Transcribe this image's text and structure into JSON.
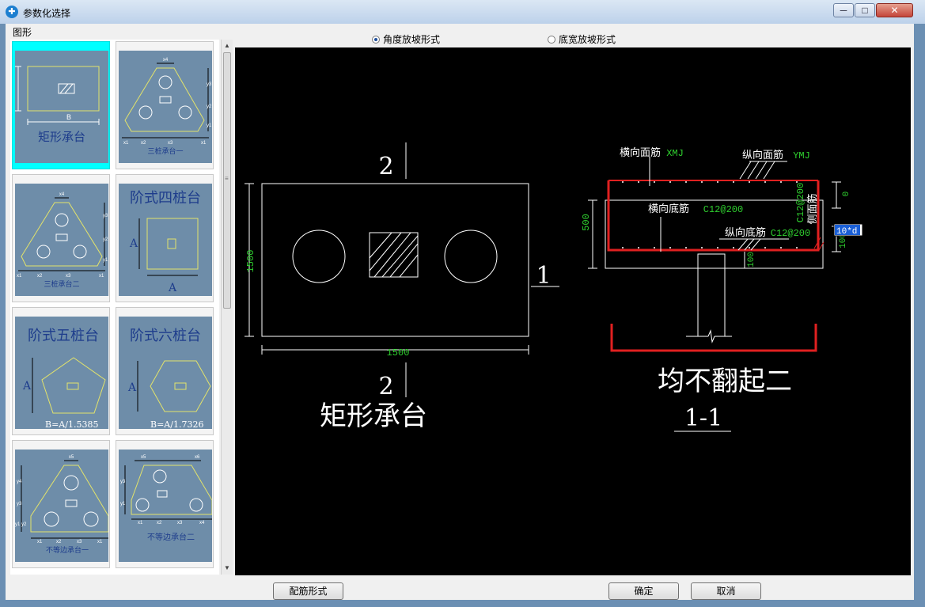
{
  "window": {
    "title": "参数化选择",
    "min": "─",
    "max": "□",
    "close": "✕"
  },
  "left_panel": {
    "group_label": "图形",
    "thumbnails": [
      {
        "label": "矩形承台",
        "dim": "B",
        "selected": true
      },
      {
        "label": "三桩承台一",
        "top_dim": "x4",
        "side_dims": [
          "y3",
          "y2",
          "y1"
        ],
        "bottom_dims": [
          "x1",
          "x2",
          "x3",
          "x1"
        ]
      },
      {
        "label": "三桩承台二",
        "top_dim": "x4",
        "side_dims": [
          "y3",
          "y2",
          "y1"
        ],
        "bottom_dims": [
          "x1",
          "x2",
          "x3",
          "x1"
        ]
      },
      {
        "label": "阶式四桩台",
        "dim_a": "A",
        "dim_b": "A"
      },
      {
        "label": "阶式五桩台",
        "dim_a": "A",
        "formula": "B=A/1.5385"
      },
      {
        "label": "阶式六桩台",
        "dim_a": "A",
        "formula": "B=A/1.7326"
      },
      {
        "label": "不等边承台一",
        "top_dim": "x5",
        "side_dims": [
          "y4",
          "y3",
          "y1 y2"
        ],
        "bottom_dims": [
          "x1",
          "x2",
          "x3",
          "x1"
        ]
      },
      {
        "label": "不等边承台二",
        "top_dims": [
          "x5",
          "x6"
        ],
        "side_dims": [
          "y3",
          "y1"
        ],
        "bottom_dims": [
          "x1",
          "x2",
          "x3",
          "x4"
        ]
      }
    ]
  },
  "radio": {
    "options": [
      "角度放坡形式",
      "底宽放坡形式"
    ],
    "selected_index": 0
  },
  "drawing": {
    "plan": {
      "title": "矩形承台",
      "section_top": "2",
      "section_bottom": "2",
      "section_side": "1",
      "dim_width": "1500",
      "dim_height": "1500"
    },
    "section": {
      "label_top_transverse": "横向面筋",
      "code_top_transverse": "XMJ",
      "label_top_longitudinal": "纵向面筋",
      "code_top_longitudinal": "YMJ",
      "label_bottom_transverse": "横向底筋",
      "code_bottom_transverse": "C12@200",
      "label_bottom_longitudinal": "纵向底筋",
      "code_bottom_longitudinal": "C12@200",
      "label_side": "侧面筋",
      "code_side": "C12@200",
      "dim_height": "500",
      "dim_top_cover": "0",
      "dim_bottom_cover": "100",
      "dim_pile_embed": "100",
      "edit_value": "10*d",
      "title": "均不翻起二",
      "section_name": "1-1"
    },
    "colors": {
      "outline": "#ffffff",
      "dim": "#2fd12f",
      "rebar": "#e02020",
      "bg": "#000000"
    }
  },
  "buttons": {
    "rebar_form": "配筋形式",
    "ok": "确定",
    "cancel": "取消"
  }
}
